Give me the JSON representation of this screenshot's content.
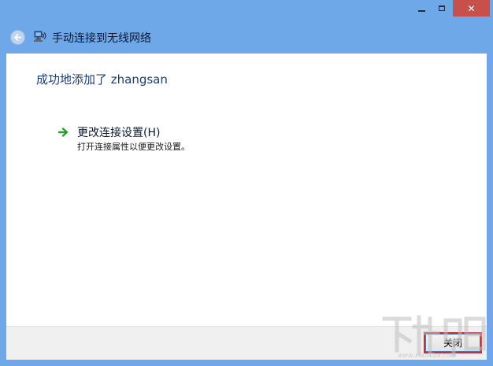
{
  "window": {
    "title": "手动连接到无线网络",
    "controls": {
      "minimize": "minimize-icon",
      "maximize": "maximize-icon",
      "close": "close-icon"
    }
  },
  "content": {
    "success_message": "成功地添加了 zhangsan",
    "task": {
      "title": "更改连接设置(H)",
      "description": "打开连接属性以便更改设置。",
      "icon": "green-arrow-icon"
    }
  },
  "footer": {
    "close_label": "关闭"
  },
  "watermark": {
    "site": "www.xiazaiba.com"
  },
  "colors": {
    "frame": "#6ea8e8",
    "close_caption": "#c7504a",
    "heading": "#1c3d73",
    "arrow": "#2e9b2e"
  }
}
